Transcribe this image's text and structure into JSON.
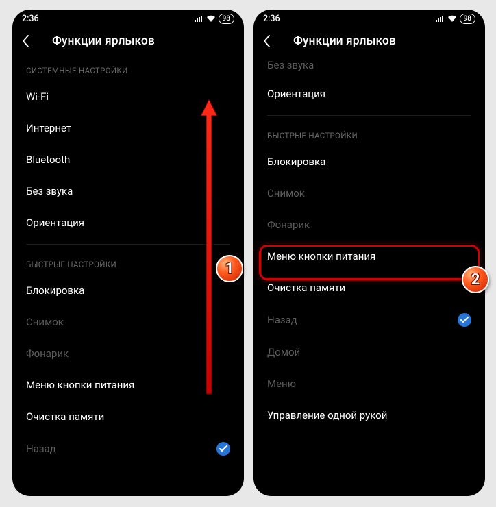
{
  "status": {
    "time": "2:36",
    "battery": "98"
  },
  "header": {
    "title": "Функции ярлыков"
  },
  "sections": {
    "system": "СИСТЕМНЫЕ НАСТРОЙКИ",
    "quick": "БЫСТРЫЕ НАСТРОЙКИ"
  },
  "items": {
    "wifi": "Wi-Fi",
    "internet": "Интернет",
    "bluetooth": "Bluetooth",
    "no_sound": "Без звука",
    "no_sound_cut": "Без звука",
    "orientation": "Ориентация",
    "lock": "Блокировка",
    "screenshot": "Снимок",
    "flashlight": "Фонарик",
    "power_menu": "Меню кнопки питания",
    "clear_memory": "Очистка памяти",
    "back": "Назад",
    "home": "Домой",
    "menu": "Меню",
    "one_hand": "Управление одной рукой"
  },
  "badges": {
    "one": "1",
    "two": "2"
  }
}
